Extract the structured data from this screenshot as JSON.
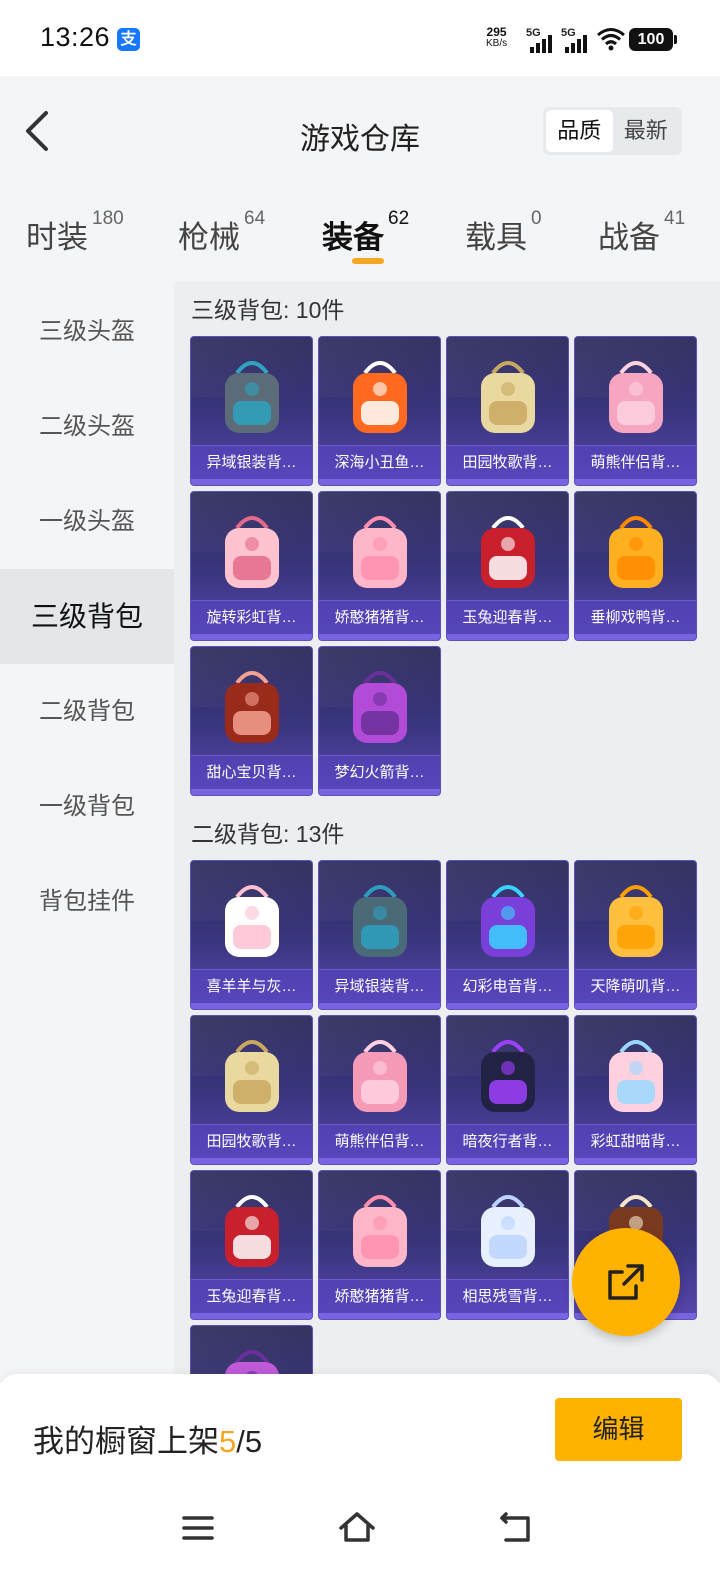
{
  "status_bar": {
    "time": "13:26",
    "alipay_glyph": "支",
    "net_speed_value": "295",
    "net_speed_unit": "KB/s",
    "sim1_tag": "5G",
    "sim2_tag": "5G",
    "battery": "100"
  },
  "header": {
    "title": "游戏仓库",
    "sort_options": [
      "品质",
      "最新"
    ]
  },
  "tabs": [
    {
      "label": "时装",
      "count": "180"
    },
    {
      "label": "枪械",
      "count": "64"
    },
    {
      "label": "装备",
      "count": "62"
    },
    {
      "label": "载具",
      "count": "0"
    },
    {
      "label": "战备",
      "count": "41"
    }
  ],
  "sidebar": {
    "items": [
      "三级头盔",
      "二级头盔",
      "一级头盔",
      "三级背包",
      "二级背包",
      "一级背包",
      "背包挂件"
    ],
    "active_index": 3
  },
  "sections": [
    {
      "title": "三级背包: 10件",
      "items": [
        "异域银装背…",
        "深海小丑鱼…",
        "田园牧歌背…",
        "萌熊伴侣背…",
        "旋转彩虹背…",
        "娇憨猪猪背…",
        "玉兔迎春背…",
        "垂柳戏鸭背…",
        "甜心宝贝背…",
        "梦幻火箭背…"
      ]
    },
    {
      "title": "二级背包: 13件",
      "items": [
        "喜羊羊与灰…",
        "异域银装背…",
        "幻彩电音背…",
        "天降萌叽背…",
        "田园牧歌背…",
        "萌熊伴侣背…",
        "暗夜行者背…",
        "彩虹甜喵背…",
        "玉兔迎春背…",
        "娇憨猪猪背…",
        "相思残雪背…",
        "",
        ""
      ]
    }
  ],
  "bottom_bar": {
    "showcase_label": "我的橱窗上架",
    "showcase_current": "5",
    "showcase_total": "/5",
    "edit_label": "编辑"
  },
  "colors": {
    "accent": "#ffb300",
    "card_gradient_top": "#2c2a5a",
    "card_gradient_bottom": "#5847b0"
  },
  "icons": {
    "back": "chevron-left-icon",
    "fab": "share-external-icon",
    "nav_menu": "menu-icon",
    "nav_home": "home-icon",
    "nav_back": "back-icon"
  }
}
